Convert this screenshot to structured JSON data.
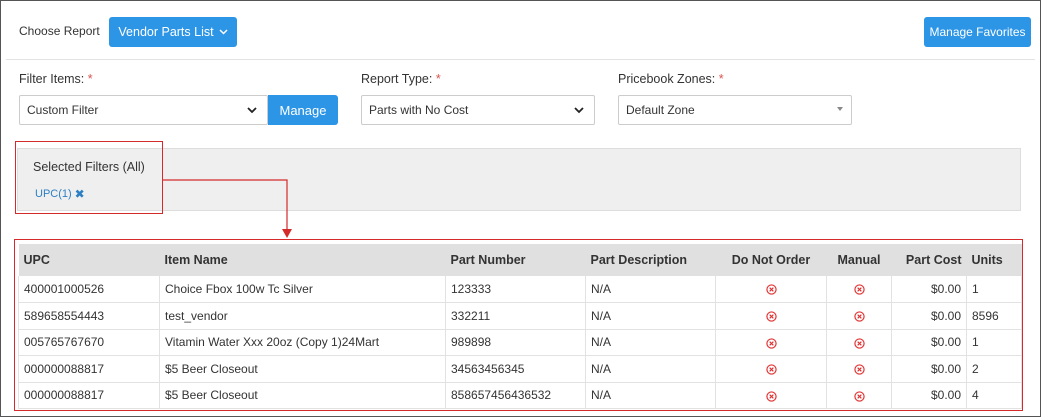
{
  "header": {
    "choose_report_label": "Choose Report",
    "report_button_label": "Vendor Parts List",
    "manage_favorites_label": "Manage Favorites"
  },
  "filters": {
    "filter_items_label": "Filter Items:",
    "filter_items_value": "Custom Filter",
    "manage_button_label": "Manage",
    "report_type_label": "Report Type:",
    "report_type_value": "Parts with No Cost",
    "pricebook_zones_label": "Pricebook Zones:",
    "pricebook_zones_value": "Default Zone",
    "required_mark": "*"
  },
  "selected_filters": {
    "title": "Selected Filters (All)",
    "chips": [
      "UPC(1)"
    ],
    "remove_glyph": "✖"
  },
  "table": {
    "columns": [
      "UPC",
      "Item Name",
      "Part Number",
      "Part Description",
      "Do Not Order",
      "Manual",
      "Part Cost",
      "Units"
    ],
    "rows": [
      [
        "400001000526",
        "Choice Fbox 100w Tc Silver",
        "123333",
        "N/A",
        "x",
        "x",
        "$0.00",
        "1"
      ],
      [
        "589658554443",
        "test_vendor",
        "332211",
        "N/A",
        "x",
        "x",
        "$0.00",
        "8596"
      ],
      [
        "005765767670",
        "Vitamin Water Xxx 20oz (Copy 1)24Mart",
        "989898",
        "N/A",
        "x",
        "x",
        "$0.00",
        "1"
      ],
      [
        "000000088817",
        "$5 Beer Closeout",
        "34563456345",
        "N/A",
        "x",
        "x",
        "$0.00",
        "2"
      ],
      [
        "000000088817",
        "$5 Beer Closeout",
        "858657456436532",
        "N/A",
        "x",
        "x",
        "$0.00",
        "4"
      ]
    ]
  },
  "colors": {
    "primary": "#2d95e6",
    "highlight": "#d52a2a",
    "status_x": "#e03232"
  },
  "icons": {
    "dropdown": "chevron-down-icon",
    "remove_chip": "close-icon",
    "status": "circle-x-icon"
  }
}
